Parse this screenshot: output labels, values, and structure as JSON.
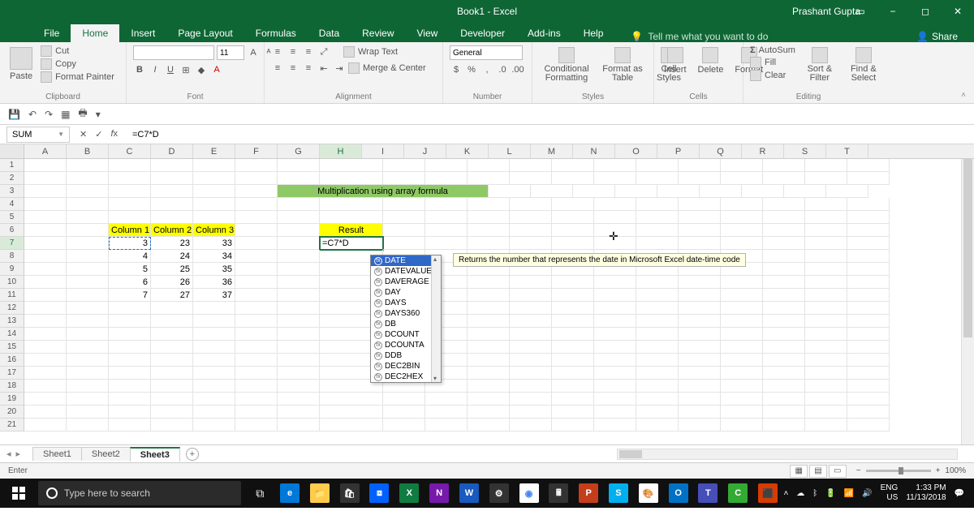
{
  "titlebar": {
    "title": "Book1 - Excel",
    "user": "Prashant Gupta"
  },
  "tabs": {
    "items": [
      "File",
      "Home",
      "Insert",
      "Page Layout",
      "Formulas",
      "Data",
      "Review",
      "View",
      "Developer",
      "Add-ins",
      "Help"
    ],
    "active": "Home",
    "tellme": "Tell me what you want to do",
    "share": "Share"
  },
  "ribbon": {
    "groups": {
      "clipboard": {
        "label": "Clipboard",
        "paste": "Paste",
        "cut": "Cut",
        "copy": "Copy",
        "painter": "Format Painter"
      },
      "font": {
        "label": "Font",
        "size": "11",
        "bold": "B",
        "italic": "I",
        "underline": "U"
      },
      "alignment": {
        "label": "Alignment",
        "wrap": "Wrap Text",
        "merge": "Merge & Center"
      },
      "number": {
        "label": "Number",
        "format": "General"
      },
      "styles": {
        "label": "Styles",
        "cond": "Conditional Formatting",
        "table": "Format as Table",
        "cell": "Cell Styles"
      },
      "cells": {
        "label": "Cells",
        "insert": "Insert",
        "delete": "Delete",
        "format": "Format"
      },
      "editing": {
        "label": "Editing",
        "autosum": "AutoSum",
        "fill": "Fill",
        "clear": "Clear",
        "sort": "Sort & Filter",
        "find": "Find & Select"
      }
    }
  },
  "formula_bar": {
    "namebox": "SUM",
    "formula": "=C7*D"
  },
  "grid": {
    "columns": [
      "A",
      "B",
      "C",
      "D",
      "E",
      "F",
      "G",
      "H",
      "I",
      "J",
      "K",
      "L",
      "M",
      "N",
      "O",
      "P",
      "Q",
      "R",
      "S",
      "T"
    ],
    "banner": "Multiplication using array formula",
    "headers": {
      "c": "Column 1",
      "d": "Column 2",
      "e": "Column 3",
      "h": "Result"
    },
    "data": [
      {
        "c": "3",
        "d": "23",
        "e": "33"
      },
      {
        "c": "4",
        "d": "24",
        "e": "34"
      },
      {
        "c": "5",
        "d": "25",
        "e": "35"
      },
      {
        "c": "6",
        "d": "26",
        "e": "36"
      },
      {
        "c": "7",
        "d": "27",
        "e": "37"
      }
    ],
    "active_cell_text": "=C7*D"
  },
  "autocomplete": {
    "items": [
      "DATE",
      "DATEVALUE",
      "DAVERAGE",
      "DAY",
      "DAYS",
      "DAYS360",
      "DB",
      "DCOUNT",
      "DCOUNTA",
      "DDB",
      "DEC2BIN",
      "DEC2HEX"
    ],
    "selected": "DATE",
    "tooltip": "Returns the number that represents the date in Microsoft Excel date-time code"
  },
  "sheets": {
    "tabs": [
      "Sheet1",
      "Sheet2",
      "Sheet3"
    ],
    "active": "Sheet3"
  },
  "statusbar": {
    "mode": "Enter",
    "zoom": "100%"
  },
  "taskbar": {
    "search_placeholder": "Type here to search",
    "lang": "ENG",
    "kb": "US",
    "time": "1:33 PM",
    "date": "11/13/2018"
  }
}
